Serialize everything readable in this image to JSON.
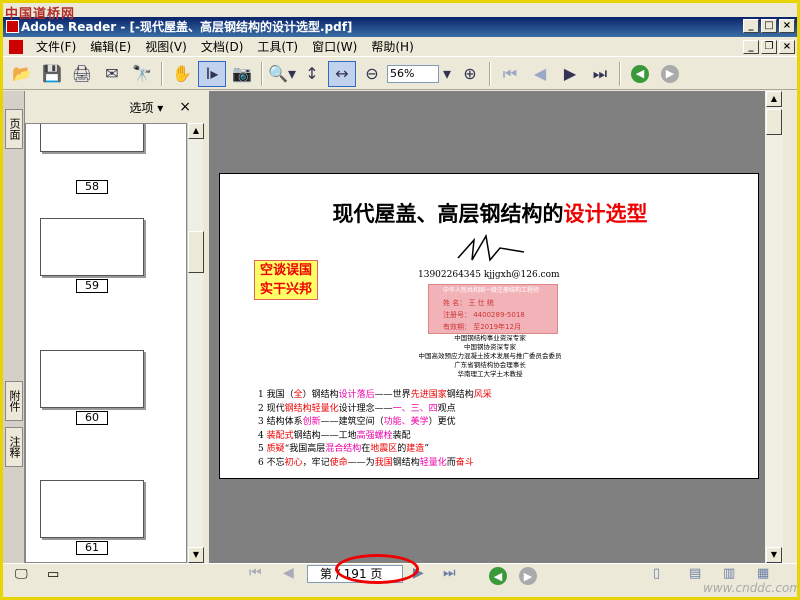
{
  "window": {
    "title": "Adobe Reader - [-现代屋盖、高层钢结构的设计选型.pdf]",
    "watermark": "中国道桥网"
  },
  "menu": [
    "文件(F)",
    "编辑(E)",
    "视图(V)",
    "文档(D)",
    "工具(T)",
    "窗口(W)",
    "帮助(H)"
  ],
  "toolbar": {
    "zoom": "56%"
  },
  "nav": {
    "options_label": "选项 ▾",
    "close": "×",
    "tabs": [
      "页面",
      "附件",
      "注释"
    ],
    "pages": [
      "58",
      "59",
      "60",
      "61"
    ]
  },
  "doc": {
    "title_black": "现代屋盖、高层钢结构的",
    "title_red": "设计选型",
    "stamp_lines": [
      "空谈误国",
      "实干兴邦"
    ],
    "contact": "13902264345   kjjgxh@126.com",
    "card_lines": [
      "姓  名：  王 仕 统",
      "注册号：  4400289-5018",
      "有效期：  至2019年12月"
    ],
    "credentials": [
      "中国钢结构事业资深专家",
      "中国钢协资深专家",
      "中国高效预应力混凝土技术发展与推广委员会委员",
      "广东省钢结构协会理事长",
      "华南理工大学土木教授"
    ],
    "items": [
      {
        "n": "1",
        "a": "我国（",
        "b": "全",
        "c": "）钢结构",
        "d": "设计落后",
        "e": "——世界",
        "f": "先进国家",
        "g": "钢结构",
        "h": "风采"
      },
      {
        "n": "2",
        "a": "现代",
        "b": "钢结构轻量化",
        "c": "设计理念——",
        "d": "一、三、四",
        "e": "观点"
      },
      {
        "n": "3",
        "a": "结构体系",
        "b": "创新",
        "c": "——建筑空间（",
        "d": "功能、美学",
        "e": "）更优"
      },
      {
        "n": "4",
        "a": "装配式",
        "b": "钢结构——工地",
        "c": "高强螺栓",
        "d": "装配"
      },
      {
        "n": "5",
        "a": "质疑",
        "b": "“我国高层",
        "c": "混合结构",
        "d": "在",
        "e": "地震区",
        "f": "的",
        "g": "建造",
        "h": "”"
      },
      {
        "n": "6",
        "a": "不忘",
        "b": "初心",
        "c": "，牢记",
        "d": "使命",
        "e": "——为",
        "f": "我国",
        "g": "钢结构",
        "h": "轻量化",
        "i": "而",
        "j": "奋斗"
      }
    ]
  },
  "status": {
    "page_field": "第 / 191 页",
    "site": "www.cnddc.com"
  }
}
